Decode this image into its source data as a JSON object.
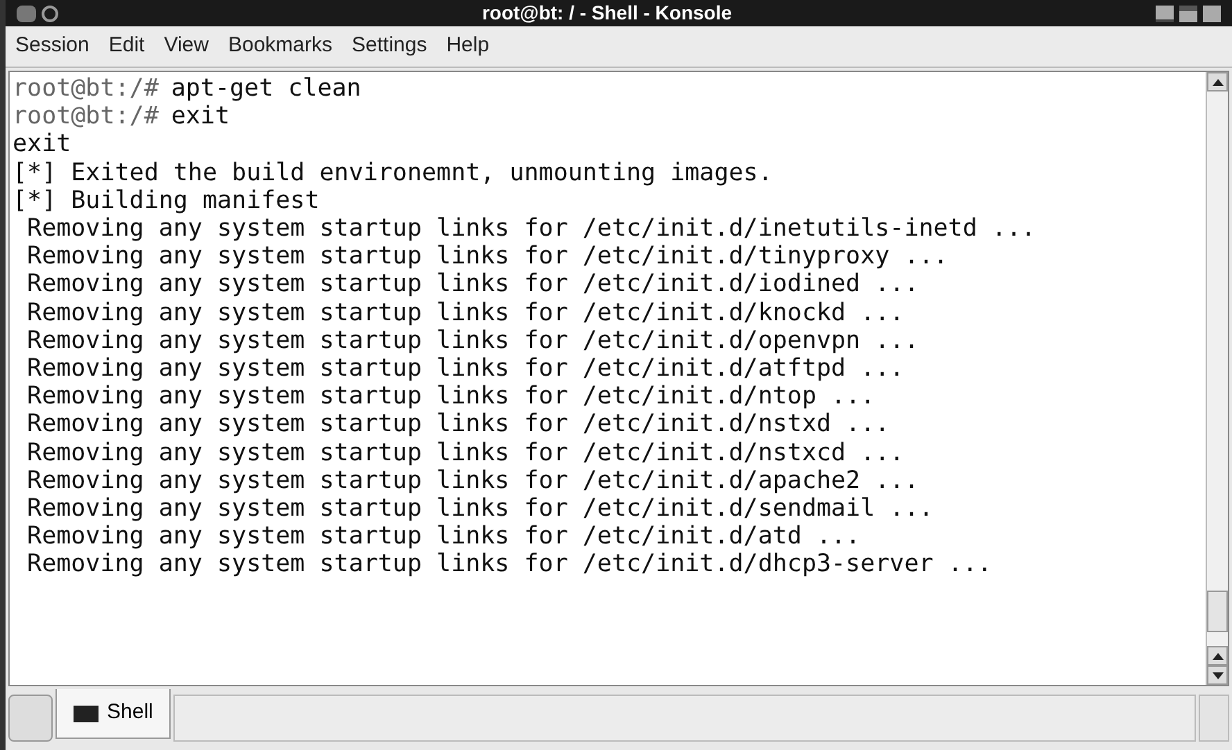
{
  "window": {
    "title": "root@bt: / - Shell - Konsole"
  },
  "menu": [
    "Session",
    "Edit",
    "View",
    "Bookmarks",
    "Settings",
    "Help"
  ],
  "terminal": {
    "lines": [
      {
        "kind": "prompt",
        "prompt": "root@bt:/#",
        "command": "apt-get clean"
      },
      {
        "kind": "prompt",
        "prompt": "root@bt:/#",
        "command": "exit"
      },
      {
        "kind": "output",
        "text": "exit"
      },
      {
        "kind": "output",
        "text": "[*] Exited the build environemnt, unmounting images."
      },
      {
        "kind": "output",
        "text": "[*] Building manifest"
      },
      {
        "kind": "output",
        "text": " Removing any system startup links for /etc/init.d/inetutils-inetd ..."
      },
      {
        "kind": "output",
        "text": " Removing any system startup links for /etc/init.d/tinyproxy ..."
      },
      {
        "kind": "output",
        "text": " Removing any system startup links for /etc/init.d/iodined ..."
      },
      {
        "kind": "output",
        "text": " Removing any system startup links for /etc/init.d/knockd ..."
      },
      {
        "kind": "output",
        "text": " Removing any system startup links for /etc/init.d/openvpn ..."
      },
      {
        "kind": "output",
        "text": " Removing any system startup links for /etc/init.d/atftpd ..."
      },
      {
        "kind": "output",
        "text": " Removing any system startup links for /etc/init.d/ntop ..."
      },
      {
        "kind": "output",
        "text": " Removing any system startup links for /etc/init.d/nstxd ..."
      },
      {
        "kind": "output",
        "text": " Removing any system startup links for /etc/init.d/nstxcd ..."
      },
      {
        "kind": "output",
        "text": " Removing any system startup links for /etc/init.d/apache2 ..."
      },
      {
        "kind": "output",
        "text": " Removing any system startup links for /etc/init.d/sendmail ..."
      },
      {
        "kind": "output",
        "text": " Removing any system startup links for /etc/init.d/atd ..."
      },
      {
        "kind": "output",
        "text": " Removing any system startup links for /etc/init.d/dhcp3-server ..."
      }
    ]
  },
  "tabs": [
    {
      "label": "Shell",
      "selected": true
    }
  ]
}
